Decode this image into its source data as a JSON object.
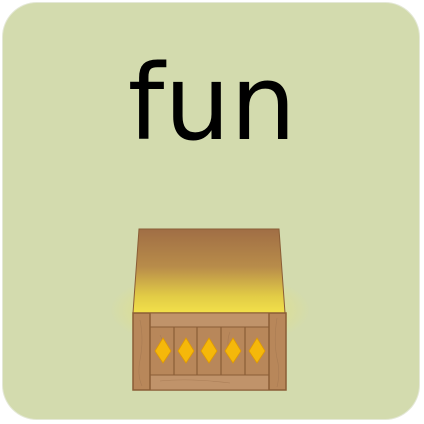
{
  "card": {
    "word": "fun",
    "background_color": "#d3dbae",
    "image": "treasure-chest",
    "gem_count": 5
  }
}
